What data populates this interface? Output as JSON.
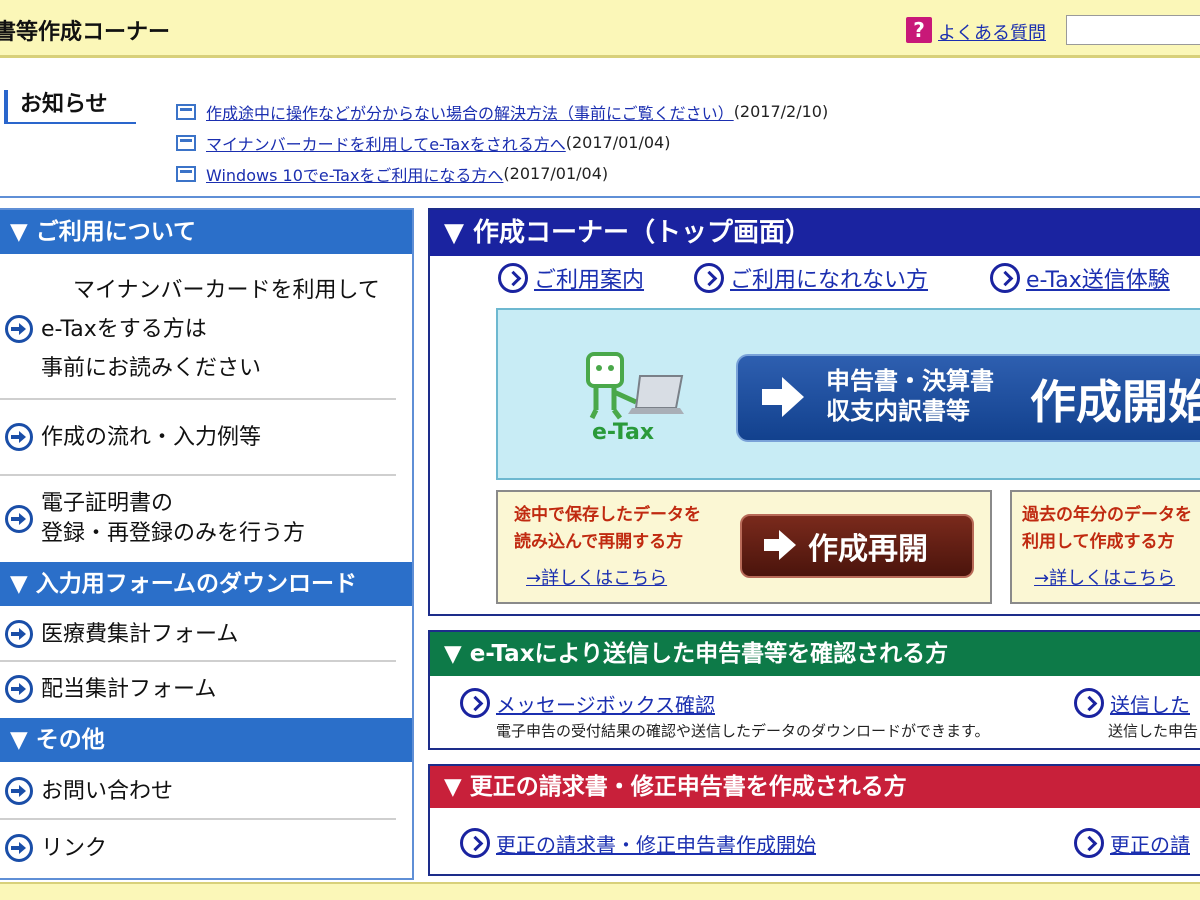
{
  "header": {
    "title": "書等作成コーナー",
    "faq_icon": "?",
    "faq_link": "よくある質問",
    "search_value": ""
  },
  "notices": {
    "label": "お知らせ",
    "items": [
      {
        "link": "作成途中に操作などが分からない場合の解決方法（事前にご覧ください）",
        "date": "(2017/2/10)"
      },
      {
        "link": "マイナンバーカードを利用してe-Taxをされる方へ",
        "date": "(2017/01/04)"
      },
      {
        "link": "Windows 10でe-Taxをご利用になる方へ",
        "date": "(2017/01/04)"
      }
    ]
  },
  "left_menu": {
    "section1": "▼ ご利用について",
    "item_mynumber": [
      "マイナンバーカードを利用して",
      "e-Taxをする方は",
      "事前にお読みください"
    ],
    "item_flow": "作成の流れ・入力例等",
    "item_cert": [
      "電子証明書の",
      "登録・再登録のみを行う方"
    ],
    "section2": "▼ 入力用フォームのダウンロード",
    "item_medical": "医療費集計フォーム",
    "item_dividend": "配当集計フォーム",
    "section3": "▼ その他",
    "item_contact": "お問い合わせ",
    "item_link": "リンク"
  },
  "main": {
    "heading": "▼ 作成コーナー（トップ画面）",
    "tabs": [
      "ご利用案内",
      "ご利用になれない方",
      "e-Tax送信体験"
    ],
    "etax_logo": "e-Tax",
    "start_sub_1": "申告書・決算書",
    "start_sub_2": "収支内訳書等",
    "start_big": "作成開始",
    "resume_text_1": "途中で保存したデータを",
    "resume_text_2": "読み込んで再開する方",
    "resume_detail": "→詳しくはこちら",
    "resume_button": "作成再開",
    "past_text_1": "過去の年分のデータを",
    "past_text_2": "利用して作成する方",
    "past_detail": "→詳しくはこちら"
  },
  "etax_section": {
    "heading": "▼ e-Taxにより送信した申告書等を確認される方",
    "link1": "メッセージボックス確認",
    "desc1": "電子申告の受付結果の確認や送信したデータのダウンロードができます。",
    "link2": "送信した",
    "desc2": "送信した申告"
  },
  "correction_section": {
    "heading": "▼ 更正の請求書・修正申告書を作成される方",
    "link1": "更正の請求書・修正申告書作成開始",
    "link2": "更正の請"
  },
  "colors": {
    "header_bg": "#fbf7b8",
    "menu_blue": "#2b6fc9",
    "main_navy": "#1a23a0",
    "etax_green": "#0d7a48",
    "correction_red": "#c8203a",
    "link_blue": "#1b2fb0"
  }
}
